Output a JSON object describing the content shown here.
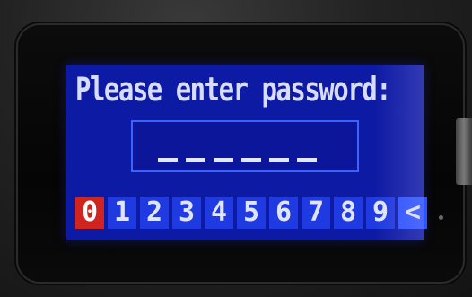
{
  "prompt": {
    "text": "Please enter password:"
  },
  "password_field": {
    "slots": [
      "",
      "",
      "",
      "",
      "",
      ""
    ]
  },
  "keypad": {
    "keys": [
      {
        "label": "0",
        "selected": true
      },
      {
        "label": "1",
        "selected": false
      },
      {
        "label": "2",
        "selected": false
      },
      {
        "label": "3",
        "selected": false
      },
      {
        "label": "4",
        "selected": false
      },
      {
        "label": "5",
        "selected": false
      },
      {
        "label": "6",
        "selected": false
      },
      {
        "label": "7",
        "selected": false
      },
      {
        "label": "8",
        "selected": false
      },
      {
        "label": "9",
        "selected": false
      },
      {
        "label": "<",
        "selected": false
      }
    ]
  },
  "colors": {
    "screen_background": "#0d1aa3",
    "key_background": "#1f3ae0",
    "selected_key": "#d0241e",
    "text": "#d8ddff"
  }
}
